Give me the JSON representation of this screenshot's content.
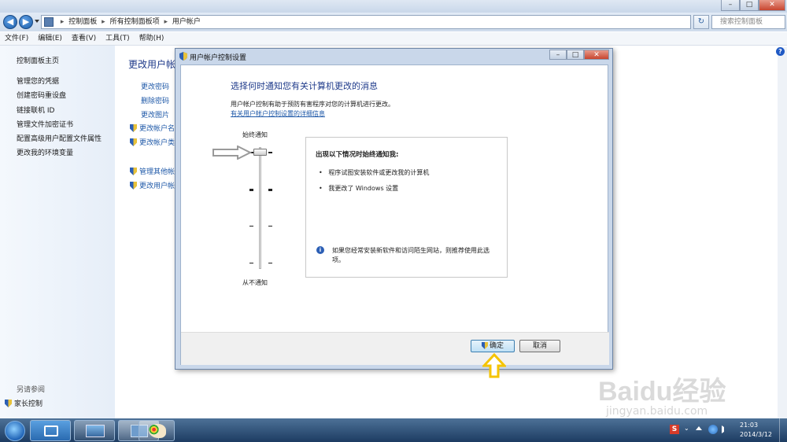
{
  "window": {
    "nav": {
      "back": "◀",
      "forward": "▶"
    },
    "address": {
      "crumbs": [
        "控制面板",
        "所有控制面板项",
        "用户帐户"
      ],
      "separator": "▸"
    },
    "search": {
      "placeholder": "搜索控制面板"
    },
    "controls": {
      "minimize": "–",
      "maximize": "□",
      "close": "✕"
    },
    "menu": [
      "文件(F)",
      "编辑(E)",
      "查看(V)",
      "工具(T)",
      "帮助(H)"
    ]
  },
  "sidebar": {
    "home": "控制面板主页",
    "links": [
      "管理您的凭据",
      "创建密码重设盘",
      "链接联机 ID",
      "管理文件加密证书",
      "配置高级用户配置文件属性",
      "更改我的环境变量"
    ],
    "see_also": "另请参阅",
    "parental": "家长控制"
  },
  "main": {
    "heading": "更改用户帐",
    "links": [
      "更改密码",
      "删除密码",
      "更改图片"
    ],
    "shield_links": [
      "更改帐户名",
      "更改帐户类"
    ],
    "shield_links2": [
      "管理其他帐",
      "更改用户帐"
    ]
  },
  "dialog": {
    "title": "用户帐户控制设置",
    "controls": {
      "minimize": "–",
      "maximize": "□",
      "close": "✕"
    },
    "heading": "选择何时通知您有关计算机更改的消息",
    "description": "用户帐户控制有助于预防有害程序对您的计算机进行更改。",
    "learn_more": "有关用户帐户控制设置的详细信息",
    "slider": {
      "top_label": "始终通知",
      "bottom_label": "从不通知",
      "level": 1.0
    },
    "info": {
      "title": "出现以下情况时始终通知我:",
      "bullets": [
        "程序试图安装软件或更改我的计算机",
        "我更改了 Windows 设置"
      ],
      "tip_icon": "i",
      "tip": "如果您经常安装新软件和访问陌生网站，则推荐使用此选项。"
    },
    "ok": "确定",
    "cancel": "取消"
  },
  "taskbar": {
    "clock_time": "21:03",
    "clock_date": "2014/3/12",
    "tray_ime": "S"
  },
  "watermark": {
    "text": "Baidu经验",
    "url": "jingyan.baidu.com"
  },
  "colors": {
    "link": "#1f59a8",
    "dialog_heading": "#1e3a8a",
    "annotation_arrow": "#f5c400"
  }
}
